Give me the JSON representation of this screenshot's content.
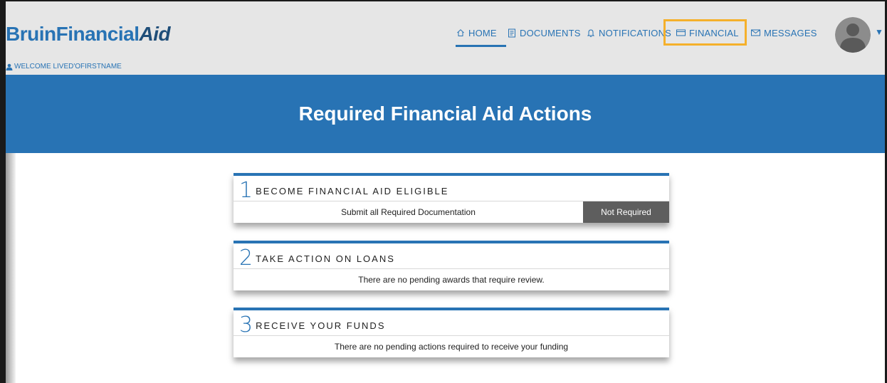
{
  "header": {
    "logo": {
      "part1": "Bruin",
      "part2": "Financial",
      "part3": "Aid"
    },
    "welcome_text": "WELCOME LIVED'OFIRSTNAME",
    "nav": [
      {
        "label": "HOME",
        "icon": "home-icon"
      },
      {
        "label": "DOCUMENTS",
        "icon": "document-icon"
      },
      {
        "label": "NOTIFICATIONS",
        "icon": "bell-icon"
      },
      {
        "label": "FINANCIAL",
        "icon": "card-icon"
      },
      {
        "label": "MESSAGES",
        "icon": "envelope-icon"
      }
    ],
    "active_nav": "HOME",
    "highlighted_nav": "FINANCIAL",
    "highlight_color": "#f5b02b",
    "caret": "▼"
  },
  "banner": {
    "title": "Required Financial Aid Actions",
    "color": "#2873b4"
  },
  "steps": [
    {
      "number": "1",
      "title": "BECOME FINANCIAL AID ELIGIBLE",
      "row_text": "Submit all Required Documentation",
      "status": "Not Required"
    },
    {
      "number": "2",
      "title": "TAKE ACTION ON LOANS",
      "row_text": "There are no pending awards that require review."
    },
    {
      "number": "3",
      "title": "RECEIVE YOUR FUNDS",
      "row_text": "There are no pending actions required to receive your funding"
    }
  ]
}
